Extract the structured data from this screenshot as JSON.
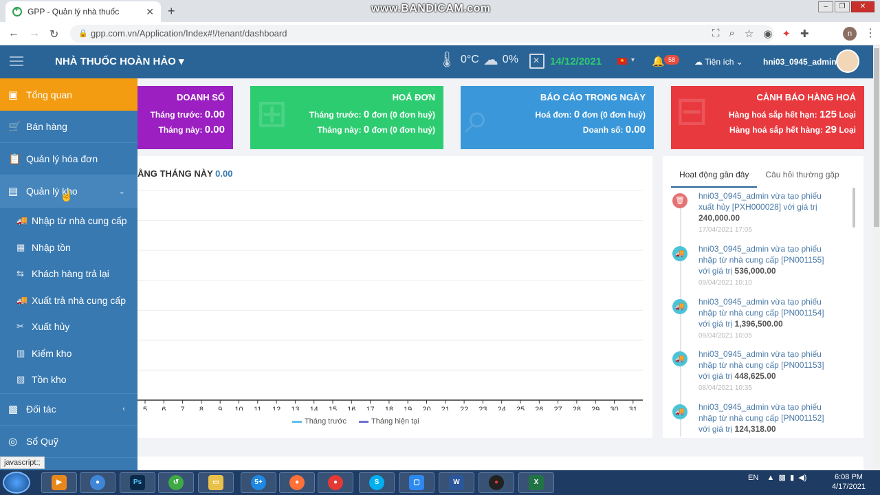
{
  "browser": {
    "tab_title": "GPP - Quản lý nhà thuốc",
    "url": "gpp.com.vn/Application/Index#!/tenant/dashboard",
    "watermark": "www.BANDICAM.com",
    "profile_initial": "n"
  },
  "header": {
    "brand": "NHÀ THUỐC HOÀN HẢO",
    "temperature": "0°C",
    "rain": "0%",
    "date": "14/12/2021",
    "notifications": "58",
    "utilities_label": "Tiện ích",
    "username": "hni03_0945_admin"
  },
  "sidebar": {
    "items": [
      {
        "label": "Tổng quan"
      },
      {
        "label": "Bán hàng"
      },
      {
        "label": "Quản lý hóa đơn"
      },
      {
        "label": "Quản lý kho"
      }
    ],
    "sub_items": [
      {
        "label": "Nhập từ nhà cung cấp"
      },
      {
        "label": "Nhập tồn"
      },
      {
        "label": "Khách hàng trả lại"
      },
      {
        "label": "Xuất trả nhà cung cấp"
      },
      {
        "label": "Xuất hủy"
      },
      {
        "label": "Kiểm kho"
      },
      {
        "label": "Tồn kho"
      }
    ],
    "bottom_items": [
      {
        "label": "Đối tác"
      },
      {
        "label": "Sổ Quỹ"
      }
    ],
    "status_text": "javascript:;"
  },
  "cards": {
    "sales": {
      "title": "DOANH SỐ",
      "prev_label": "Tháng trước:",
      "prev_value": "0.00",
      "cur_label": "Tháng này:",
      "cur_value": "0.00",
      "color": "#9b1fc1"
    },
    "invoices": {
      "title": "HOÁ ĐƠN",
      "prev_label": "Tháng trước:",
      "prev_count": "0",
      "prev_suffix": "đơn (0 đơn huỷ)",
      "cur_label": "Tháng này:",
      "cur_count": "0",
      "cur_suffix": "đơn (0 đơn huỷ)",
      "color": "#2ecc71"
    },
    "daily": {
      "title": "BÁO CÁO TRONG NGÀY",
      "inv_label": "Hoá đơn:",
      "inv_count": "0",
      "inv_suffix": "đơn (0 đơn huỷ)",
      "sales_label": "Doanh số:",
      "sales_value": "0.00",
      "color": "#3a97d9"
    },
    "warning": {
      "title": "CẢNH BÁO HÀNG HOÁ",
      "expire_label": "Hàng hoá sắp hết hạn:",
      "expire_count": "125",
      "expire_unit": "Loại",
      "stock_label": "Hàng hoá sắp hết hàng:",
      "stock_count": "29",
      "stock_unit": "Loại",
      "color": "#e8393f"
    }
  },
  "chart": {
    "title_prefix": "ẰNG THÁNG NÀY",
    "title_value": "0.00",
    "legend_prev": "Tháng trước",
    "legend_cur": "Tháng hiện tại",
    "legend_prev_color": "#5bc0eb",
    "legend_cur_color": "#6c6fd1"
  },
  "chart_data": {
    "type": "line",
    "title": "ẰNG THÁNG NÀY 0.00",
    "categories": [
      "5",
      "6",
      "7",
      "8",
      "9",
      "10",
      "11",
      "12",
      "13",
      "14",
      "15",
      "16",
      "17",
      "18",
      "19",
      "20",
      "21",
      "22",
      "23",
      "24",
      "25",
      "26",
      "27",
      "28",
      "29",
      "30",
      "31"
    ],
    "series": [
      {
        "name": "Tháng trước",
        "values": []
      },
      {
        "name": "Tháng hiện tại",
        "values": []
      }
    ],
    "grid": true,
    "legend": "bottom"
  },
  "activity": {
    "tab_recent": "Hoạt động gần đây",
    "tab_faq": "Câu hỏi thường gặp",
    "items": [
      {
        "text": "hni03_0945_admin vừa tạo phiếu xuất hủy [PXH000028] với giá trị",
        "value": "240,000.00",
        "time": "17/04/2021 17:05",
        "kind": "trash"
      },
      {
        "text": "hni03_0945_admin vừa tạo phiếu nhập từ nhà cung cấp [PN001155] với giá trị",
        "value": "536,000.00",
        "time": "09/04/2021 10:10",
        "kind": "truck"
      },
      {
        "text": "hni03_0945_admin vừa tạo phiếu nhập từ nhà cung cấp [PN001154] với giá trị",
        "value": "1,396,500.00",
        "time": "09/04/2021 10:05",
        "kind": "truck"
      },
      {
        "text": "hni03_0945_admin vừa tạo phiếu nhập từ nhà cung cấp [PN001153] với giá trị",
        "value": "448,625.00",
        "time": "08/04/2021 10:35",
        "kind": "truck"
      },
      {
        "text": "hni03_0945_admin vừa tạo phiếu nhập từ nhà cung cấp [PN001152] với giá trị",
        "value": "124,318.00",
        "time": "",
        "kind": "truck"
      }
    ]
  },
  "taskbar": {
    "lang": "EN",
    "time": "6:08 PM",
    "date": "4/17/2021",
    "zalo_badge": "5+"
  }
}
